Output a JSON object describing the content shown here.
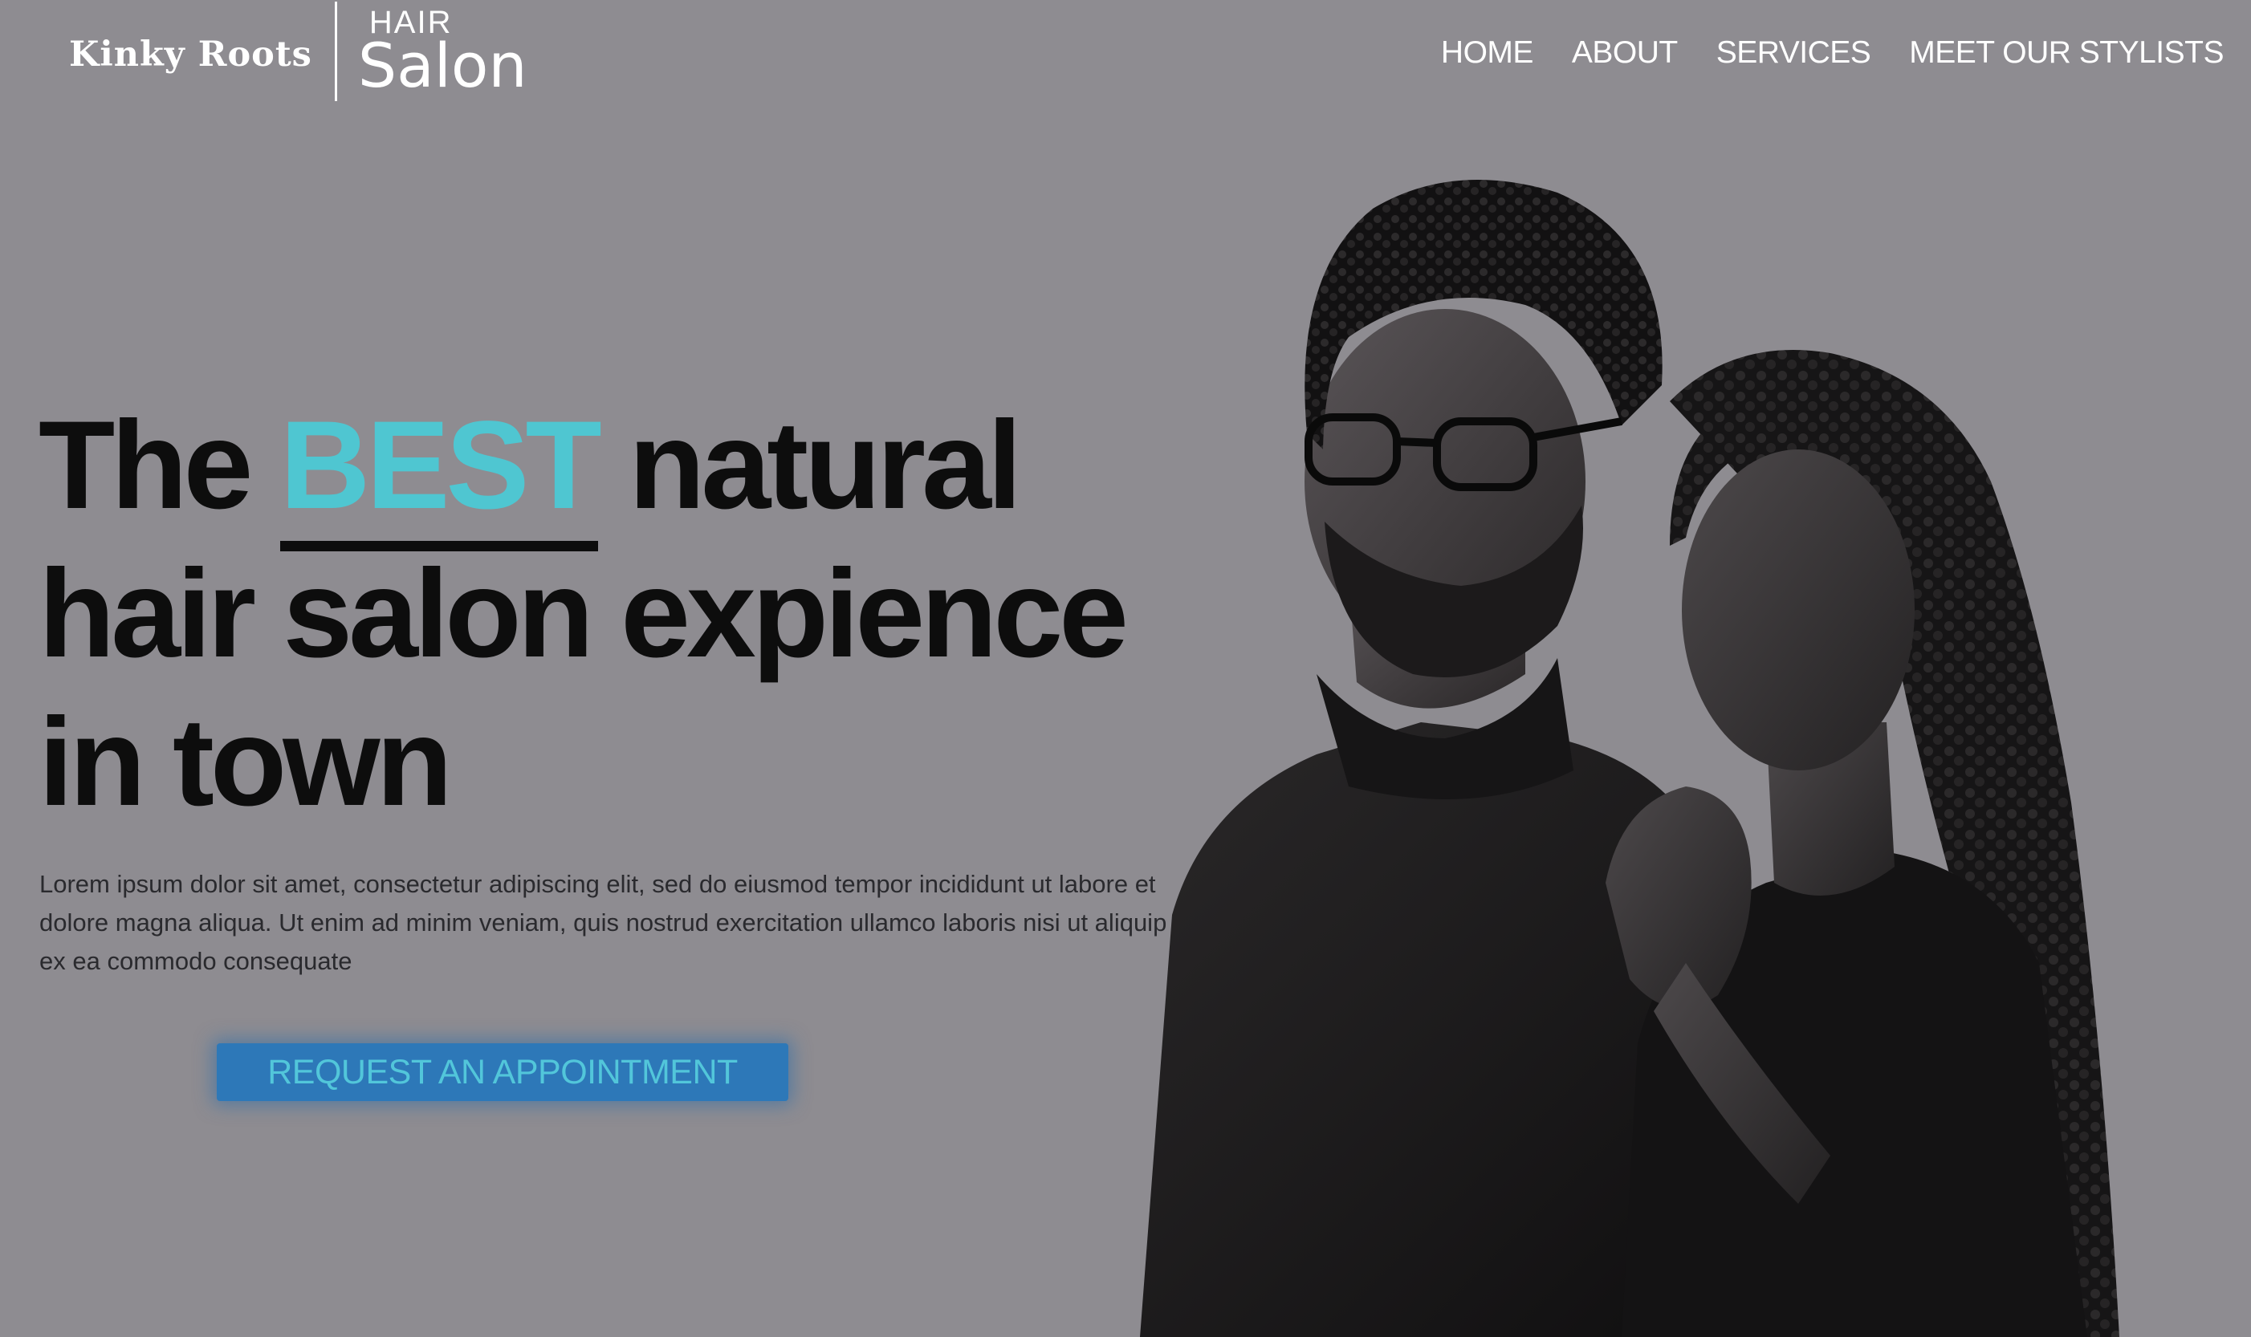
{
  "brand": {
    "name": "Kinky Roots",
    "line1": "HAIR",
    "line2": "Salon"
  },
  "nav": {
    "items": [
      "HOME",
      "ABOUT",
      "SERVICES",
      "MEET OUR STYLISTS"
    ]
  },
  "hero": {
    "headline_pre": "The ",
    "headline_accent": "BEST",
    "headline_post": " natural hair salon expience in town",
    "body": "Lorem ipsum dolor sit amet, consectetur adipiscing elit, sed do eiusmod tempor incididunt ut labore et dolore magna aliqua. Ut enim ad minim veniam, quis nostrud exercitation ullamco laboris nisi ut aliquip ex ea commodo consequate",
    "cta_label": "REQUEST AN APPOINTMENT",
    "image": "black-and-white portrait of a couple"
  },
  "colors": {
    "background": "#8e8c91",
    "accent": "#4fc6d1",
    "button": "#2d78b8",
    "button_text": "#52c6da",
    "headline": "#0d0d0d"
  }
}
